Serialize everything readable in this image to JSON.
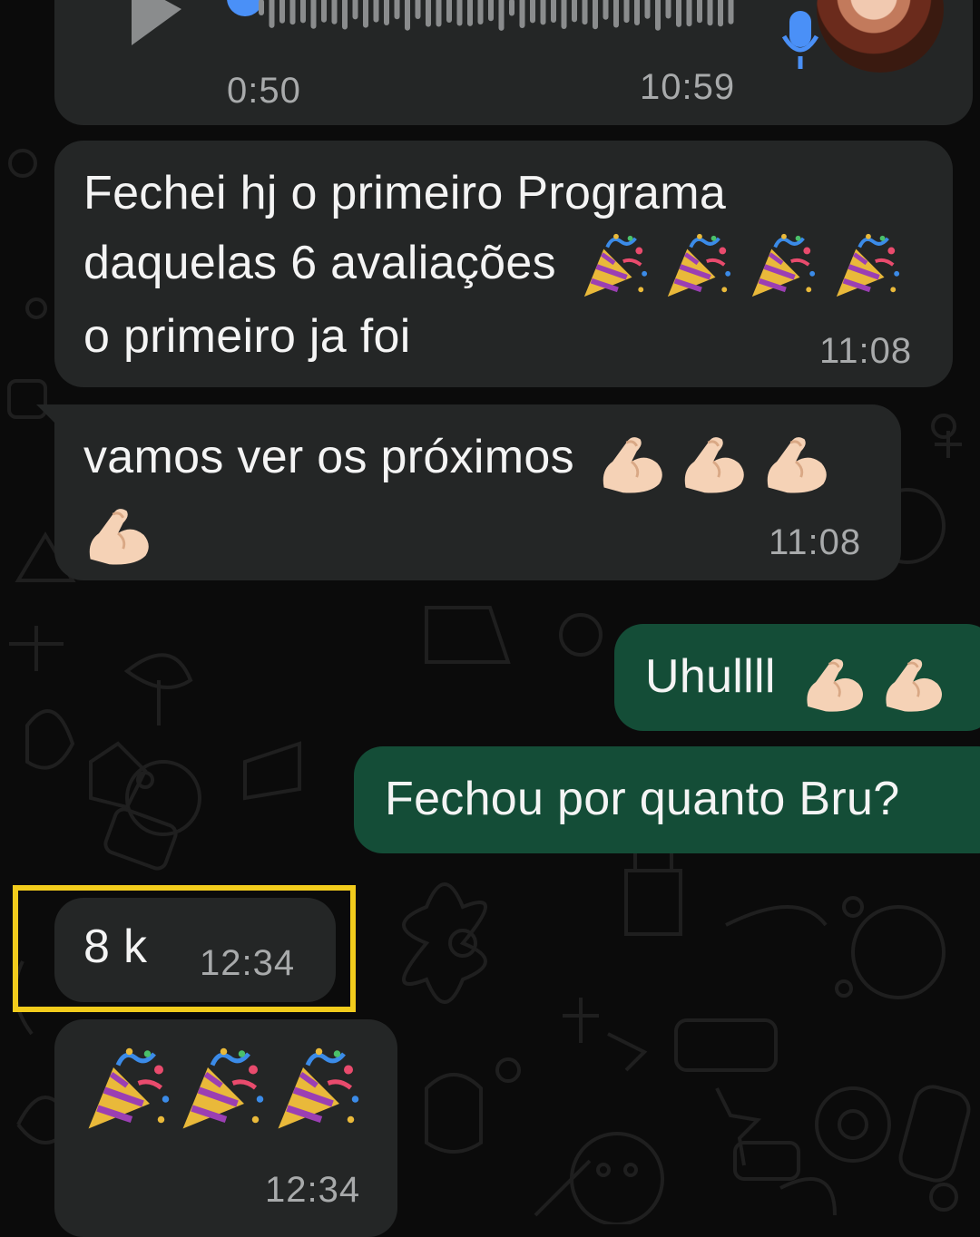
{
  "voice_message": {
    "duration": "0:50",
    "time": "10:59",
    "progress": 0.0
  },
  "messages": [
    {
      "direction": "in",
      "text_line1": "Fechei hj o primeiro Programa",
      "text_line2": "daquelas 6 avaliações",
      "text_line3": "o primeiro ja foi",
      "emojis": [
        "party-popper",
        "party-popper",
        "party-popper",
        "party-popper"
      ],
      "time": "11:08"
    },
    {
      "direction": "in",
      "text": "vamos ver os próximos",
      "emojis": [
        "flexed-biceps",
        "flexed-biceps",
        "flexed-biceps",
        "flexed-biceps"
      ],
      "time": "11:08"
    },
    {
      "direction": "out",
      "text": "Uhullll",
      "emojis": [
        "flexed-biceps",
        "flexed-biceps"
      ]
    },
    {
      "direction": "out",
      "text": "Fechou por quanto Bru?"
    },
    {
      "direction": "in",
      "text": "8 k",
      "time": "12:34",
      "highlighted": true
    },
    {
      "direction": "in",
      "emojis": [
        "party-popper",
        "party-popper",
        "party-popper"
      ],
      "time": "12:34"
    }
  ],
  "colors": {
    "incoming_bubble": "#242626",
    "outgoing_bubble": "#144d37",
    "highlight_box": "#f2cc1c",
    "voice_accent": "#4a90f7"
  }
}
